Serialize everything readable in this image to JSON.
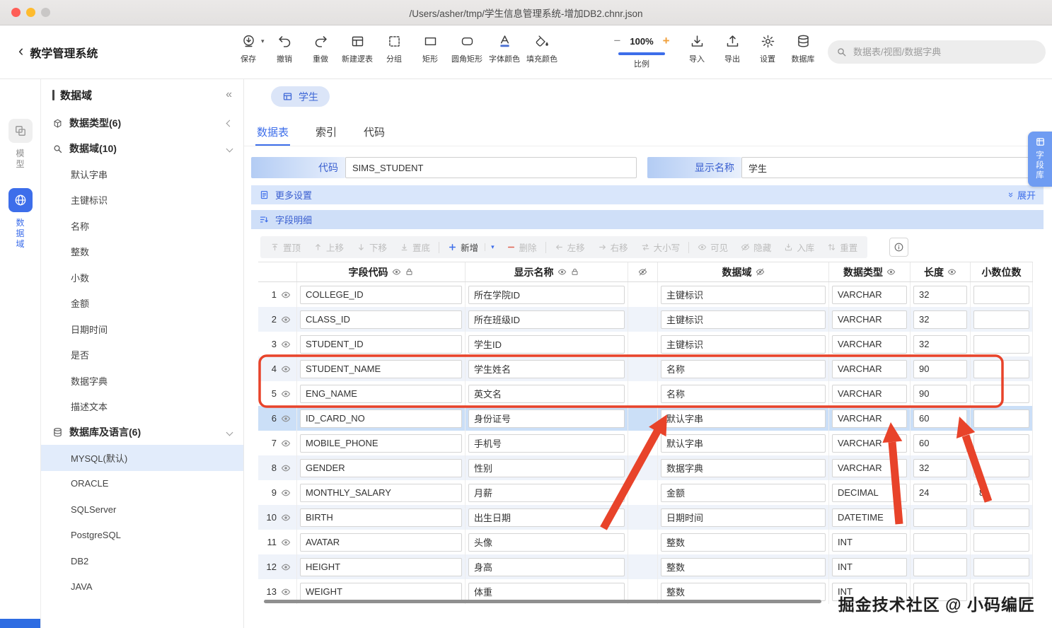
{
  "window": {
    "title": "/Users/asher/tmp/学生信息管理系统-增加DB2.chnr.json"
  },
  "toolbar": {
    "back_label": "教学管理系统",
    "buttons": [
      {
        "label": "保存",
        "icon": "save",
        "caret": true
      },
      {
        "label": "撤销",
        "icon": "undo"
      },
      {
        "label": "重做",
        "icon": "redo"
      },
      {
        "label": "新建逻表",
        "icon": "newtable"
      },
      {
        "label": "分组",
        "icon": "group"
      },
      {
        "label": "矩形",
        "icon": "rect"
      },
      {
        "label": "圆角矩形",
        "icon": "rrect"
      },
      {
        "label": "字体颜色",
        "icon": "fontcolor"
      },
      {
        "label": "填充颜色",
        "icon": "fillcolor"
      }
    ],
    "zoom": {
      "minus": "−",
      "value": "100%",
      "plus": "+",
      "label": "比例"
    },
    "right_buttons": [
      {
        "label": "导入",
        "icon": "import"
      },
      {
        "label": "导出",
        "icon": "export"
      },
      {
        "label": "设置",
        "icon": "settings"
      },
      {
        "label": "数据库",
        "icon": "database"
      }
    ],
    "search_placeholder": "数据表/视图/数据字典"
  },
  "rail": {
    "items": [
      {
        "label": "模型"
      },
      {
        "label": "数据域",
        "active": true
      }
    ]
  },
  "sidebar": {
    "header": "数据域",
    "collapse_icon": "«",
    "groups": [
      {
        "label": "数据类型(6)",
        "collapsed": true,
        "items": []
      },
      {
        "label": "数据域(10)",
        "collapsed": false,
        "items": [
          "默认字串",
          "主键标识",
          "名称",
          "整数",
          "小数",
          "金额",
          "日期时间",
          "是否",
          "数据字典",
          "描述文本"
        ]
      },
      {
        "label": "数据库及语言(6)",
        "collapsed": false,
        "selected": "MYSQL(默认)",
        "items": [
          "MYSQL(默认)",
          "ORACLE",
          "SQLServer",
          "PostgreSQL",
          "DB2",
          "JAVA"
        ]
      }
    ]
  },
  "main": {
    "entity_tab": "学生",
    "tabs": [
      "数据表",
      "索引",
      "代码"
    ],
    "active_tab": "数据表",
    "form": {
      "code_label": "代码",
      "code_value": "SIMS_STUDENT",
      "name_label": "显示名称",
      "name_value": "学生"
    },
    "more_settings_label": "更多设置",
    "expand_label": "展开",
    "field_detail_label": "字段明细",
    "grid_toolbar": [
      {
        "label": "置顶",
        "icon": "top",
        "enabled": false
      },
      {
        "label": "上移",
        "icon": "up",
        "enabled": false
      },
      {
        "label": "下移",
        "icon": "down",
        "enabled": false
      },
      {
        "label": "置底",
        "icon": "bottom",
        "enabled": false
      },
      {
        "label": "新增",
        "icon": "plus",
        "enabled": true,
        "dropdown": true,
        "sep_before": true,
        "icon_color": "#3d6eea"
      },
      {
        "label": "删除",
        "icon": "minus",
        "enabled": false,
        "icon_color": "#e0614f"
      },
      {
        "label": "左移",
        "icon": "left",
        "enabled": false,
        "sep_before": true
      },
      {
        "label": "右移",
        "icon": "right",
        "enabled": false
      },
      {
        "label": "大小写",
        "icon": "case",
        "enabled": false
      },
      {
        "label": "可见",
        "icon": "eye",
        "enabled": false,
        "sep_before": true
      },
      {
        "label": "隐藏",
        "icon": "eyeoff",
        "enabled": false
      },
      {
        "label": "入库",
        "icon": "indb",
        "enabled": false
      },
      {
        "label": "重置",
        "icon": "reset",
        "enabled": false
      }
    ],
    "table": {
      "headers": [
        "字段代码",
        "显示名称",
        "数据域",
        "数据类型",
        "长度",
        "小数位数"
      ],
      "rows": [
        {
          "n": 1,
          "code": "COLLEGE_ID",
          "name": "所在学院ID",
          "domain": "主键标识",
          "type": "VARCHAR",
          "len": "32",
          "dec": ""
        },
        {
          "n": 2,
          "code": "CLASS_ID",
          "name": "所在班级ID",
          "domain": "主键标识",
          "type": "VARCHAR",
          "len": "32",
          "dec": ""
        },
        {
          "n": 3,
          "code": "STUDENT_ID",
          "name": "学生ID",
          "domain": "主键标识",
          "type": "VARCHAR",
          "len": "32",
          "dec": ""
        },
        {
          "n": 4,
          "code": "STUDENT_NAME",
          "name": "学生姓名",
          "domain": "名称",
          "type": "VARCHAR",
          "len": "90",
          "dec": ""
        },
        {
          "n": 5,
          "code": "ENG_NAME",
          "name": "英文名",
          "domain": "名称",
          "type": "VARCHAR",
          "len": "90",
          "dec": ""
        },
        {
          "n": 6,
          "code": "ID_CARD_NO",
          "name": "身份证号",
          "domain": "默认字串",
          "type": "VARCHAR",
          "len": "60",
          "dec": "",
          "selected": true
        },
        {
          "n": 7,
          "code": "MOBILE_PHONE",
          "name": "手机号",
          "domain": "默认字串",
          "type": "VARCHAR",
          "len": "60",
          "dec": ""
        },
        {
          "n": 8,
          "code": "GENDER",
          "name": "性别",
          "domain": "数据字典",
          "type": "VARCHAR",
          "len": "32",
          "dec": ""
        },
        {
          "n": 9,
          "code": "MONTHLY_SALARY",
          "name": "月薪",
          "domain": "金额",
          "type": "DECIMAL",
          "len": "24",
          "dec": "8"
        },
        {
          "n": 10,
          "code": "BIRTH",
          "name": "出生日期",
          "domain": "日期时间",
          "type": "DATETIME",
          "len": "",
          "dec": ""
        },
        {
          "n": 11,
          "code": "AVATAR",
          "name": "头像",
          "domain": "整数",
          "type": "INT",
          "len": "",
          "dec": ""
        },
        {
          "n": 12,
          "code": "HEIGHT",
          "name": "身高",
          "domain": "整数",
          "type": "INT",
          "len": "",
          "dec": ""
        },
        {
          "n": 13,
          "code": "WEIGHT",
          "name": "体重",
          "domain": "整数",
          "type": "INT",
          "len": "",
          "dec": ""
        }
      ]
    },
    "field_lib_label": "字段库",
    "watermark": "掘金技术社区 @ 小码编匠"
  },
  "colors": {
    "accent": "#3d6eea",
    "annotation": "#e8432a",
    "selected_row": "#cbdff7",
    "band": "#d9e6fb"
  }
}
